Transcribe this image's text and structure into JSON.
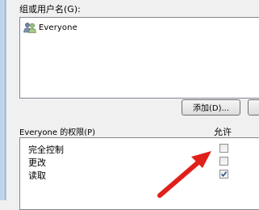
{
  "group_section": {
    "label": "组或用户名(G):",
    "items": [
      {
        "name": "Everyone",
        "icon": "users-icon"
      }
    ]
  },
  "buttons": {
    "add_label": "添加(D)...",
    "remove_label": ""
  },
  "permissions": {
    "label": "Everyone 的权限(P)",
    "allow_header": "允许",
    "rows": [
      {
        "name": "完全控制",
        "allow": false
      },
      {
        "name": "更改",
        "allow": false
      },
      {
        "name": "读取",
        "allow": true
      }
    ]
  },
  "colors": {
    "annotation_arrow": "#e0201b",
    "checkmark": "#2b4e8c"
  }
}
